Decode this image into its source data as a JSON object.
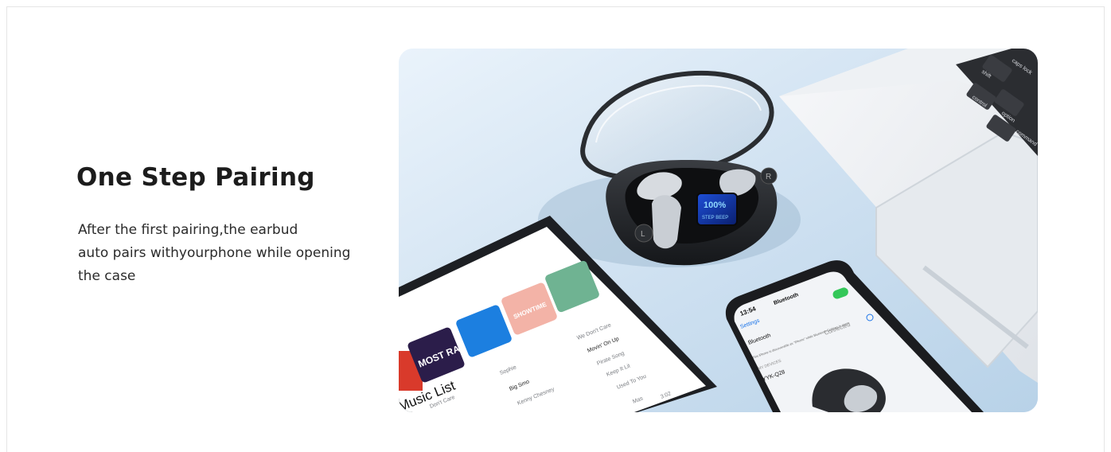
{
  "feature": {
    "title": "One Step Pairing",
    "description_lines": [
      "After the first pairing,the earbud",
      "auto pairs withyourphone while opening",
      "the case"
    ]
  },
  "hero_image": {
    "case_display": {
      "battery": "100%",
      "status": "STEP BEEP"
    },
    "tablet": {
      "list_title": "Music List",
      "albums": [
        "MOST RATED",
        "SHOWTIME"
      ],
      "rows": [
        {
          "left": "Big Smo",
          "right": "Movin' On Up"
        },
        {
          "left": "Kenny Chesney",
          "right": "Pirate Song"
        },
        {
          "left": "Don't Care",
          "right": "Keep It Lit"
        },
        {
          "left": "Sophie",
          "right": "We Don't Care"
        }
      ],
      "extra": [
        "Used To You",
        "3:02",
        "Mas"
      ]
    },
    "phone": {
      "time": "13:54",
      "screen_title": "Bluetooth",
      "back_label": "Settings",
      "section": "Bluetooth",
      "note": "This iPhone is discoverable as \"iPhone\" while Bluetooth Settings is open.",
      "my_devices": "MY DEVICES",
      "device_name": "YYK-Q28",
      "device_status": "Connected"
    },
    "keyboard_keys": [
      "caps lock",
      "shift",
      "control",
      "option",
      "command"
    ]
  }
}
